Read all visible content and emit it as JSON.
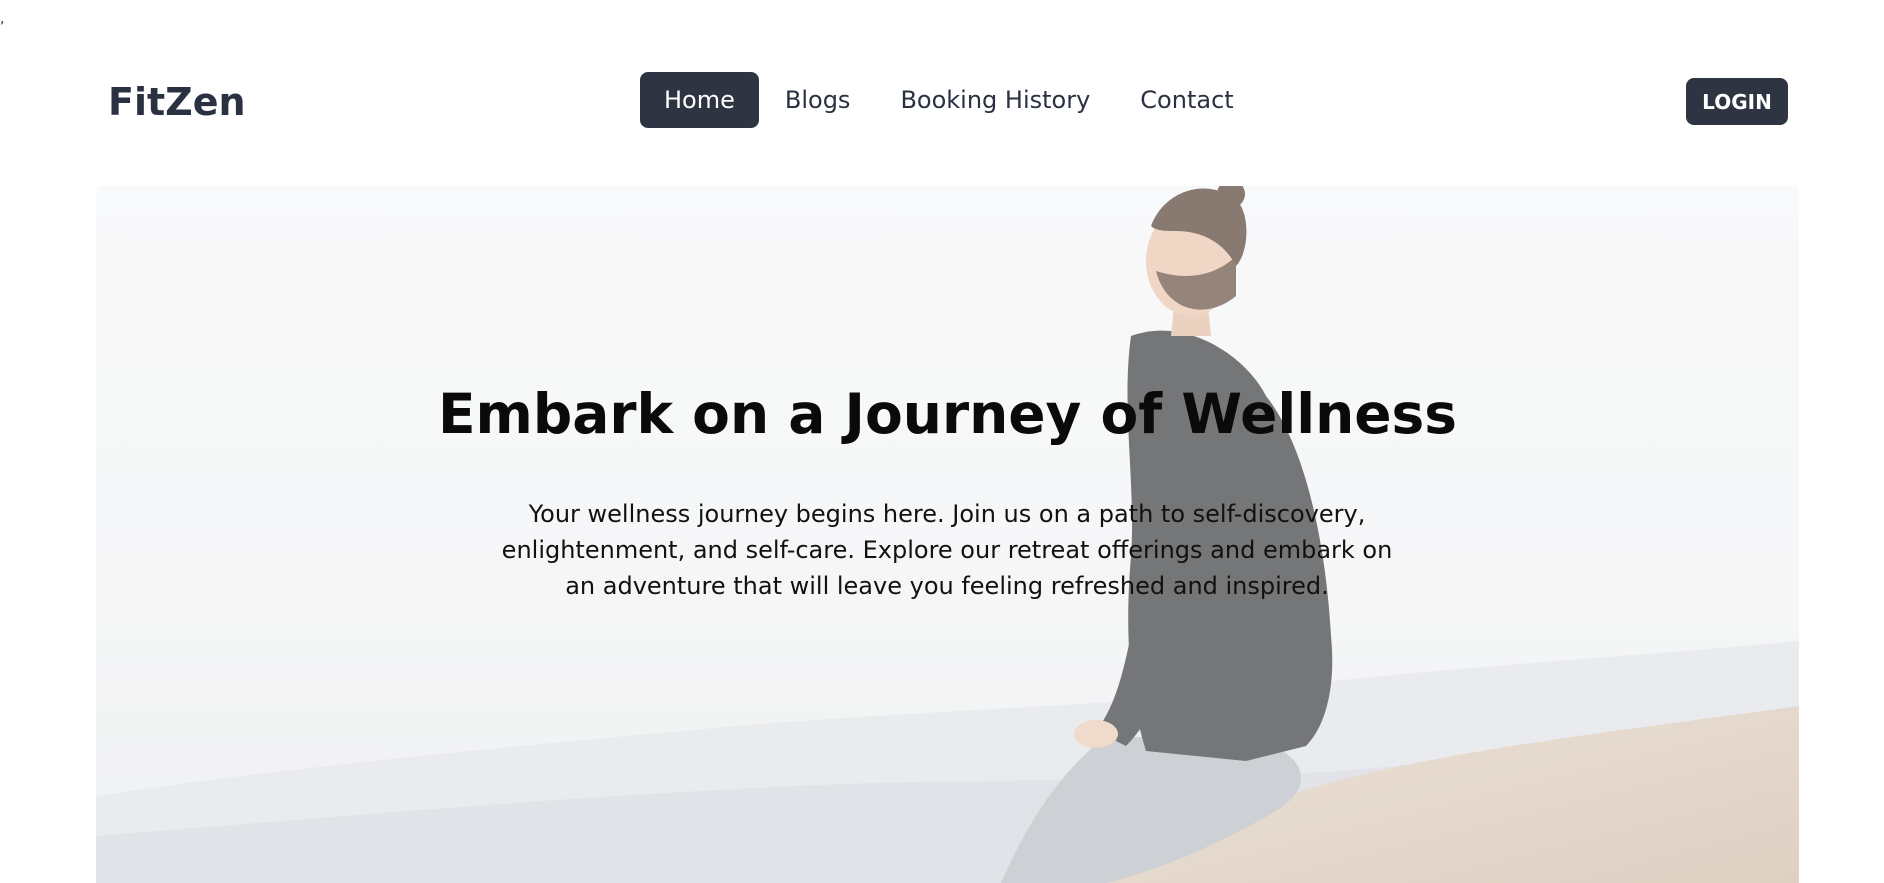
{
  "stray_mark": ",",
  "navbar": {
    "brand": "FitZen",
    "links": [
      {
        "label": "Home",
        "active": true
      },
      {
        "label": "Blogs",
        "active": false
      },
      {
        "label": "Booking History",
        "active": false
      },
      {
        "label": "Contact",
        "active": false
      }
    ],
    "login_label": "LOGIN"
  },
  "hero": {
    "title": "Embark on a Journey of Wellness",
    "text": "Your wellness journey begins here. Join us on a path to self-discovery, enlightenment, and self-care. Explore our retreat offerings and embark on an adventure that will leave you feeling refreshed and inspired.",
    "image_description_icon": "man-on-mountain-photo"
  },
  "colors": {
    "accent": "#2e3442",
    "brand_text": "#2a3140",
    "hero_title": "#0a0a0a"
  }
}
